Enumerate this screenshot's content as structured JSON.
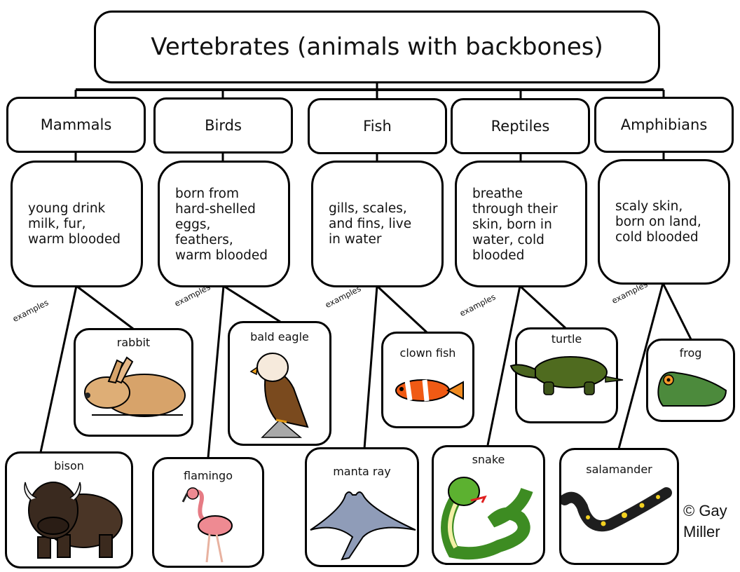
{
  "title": "Vertebrates (animals with backbones)",
  "categories": [
    {
      "name": "Mammals",
      "description": "young drink\nmilk, fur,\nwarm blooded",
      "examples_label": "examples",
      "examples": [
        "rabbit",
        "bison"
      ]
    },
    {
      "name": "Birds",
      "description": "born from\nhard-shelled\neggs,\nfeathers,\nwarm blooded",
      "examples_label": "examples",
      "examples": [
        "bald eagle",
        "flamingo"
      ]
    },
    {
      "name": "Fish",
      "description": "gills, scales,\nand fins, live\nin water",
      "examples_label": "examples",
      "examples": [
        "clown fish",
        "manta ray"
      ]
    },
    {
      "name": "Reptiles",
      "description": "breathe\nthrough their\nskin, born in\nwater, cold\nblooded",
      "examples_label": "examples",
      "examples": [
        "turtle",
        "snake"
      ]
    },
    {
      "name": "Amphibians",
      "description": "scaly skin,\nborn on land,\ncold blooded",
      "examples_label": "examples",
      "examples": [
        "frog",
        "salamander"
      ]
    }
  ],
  "copyright": "© Gay\nMiller"
}
